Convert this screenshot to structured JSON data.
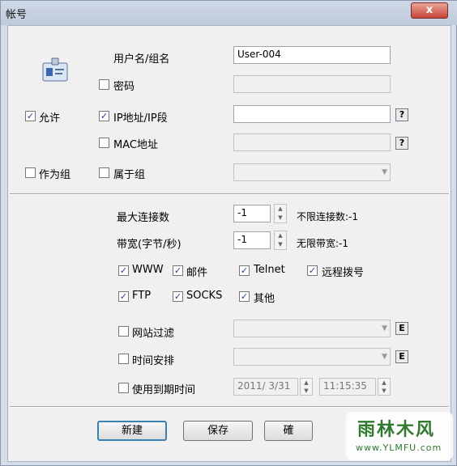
{
  "window": {
    "title": "帐号",
    "close_label": "x"
  },
  "account": {
    "username_label": "用户名/组名",
    "username_value": "User-004",
    "password_label": "密码",
    "password_checked": false,
    "allow_label": "允许",
    "allow_checked": true,
    "ip_label": "IP地址/IP段",
    "ip_checked": true,
    "ip_value": "",
    "ip_help": "?",
    "mac_label": "MAC地址",
    "mac_checked": false,
    "mac_help": "?",
    "as_group_label": "作为组",
    "as_group_checked": false,
    "member_of_label": "属于组",
    "member_of_checked": false
  },
  "limits": {
    "max_conn_label": "最大连接数",
    "max_conn_value": "-1",
    "max_conn_hint": "不限连接数:-1",
    "bandwidth_label": "带宽(字节/秒)",
    "bandwidth_value": "-1",
    "bandwidth_hint": "无限带宽:-1"
  },
  "services": [
    {
      "label": "WWW",
      "checked": true
    },
    {
      "label": "邮件",
      "checked": true
    },
    {
      "label": "Telnet",
      "checked": true
    },
    {
      "label": "远程拨号",
      "checked": true
    },
    {
      "label": "FTP",
      "checked": true
    },
    {
      "label": "SOCKS",
      "checked": true
    },
    {
      "label": "其他",
      "checked": true
    }
  ],
  "filters": {
    "site_filter_label": "网站过滤",
    "site_filter_checked": false,
    "site_filter_edit": "E",
    "schedule_label": "时间安排",
    "schedule_checked": false,
    "schedule_edit": "E",
    "expiry_label": "使用到期时间",
    "expiry_checked": false,
    "expiry_date": "2011/ 3/31",
    "expiry_time": "11:15:35"
  },
  "buttons": {
    "new": "新建",
    "save": "保存",
    "third": "確"
  },
  "watermark": {
    "main": "雨林木风",
    "sub": "www.YLMFU.com"
  }
}
